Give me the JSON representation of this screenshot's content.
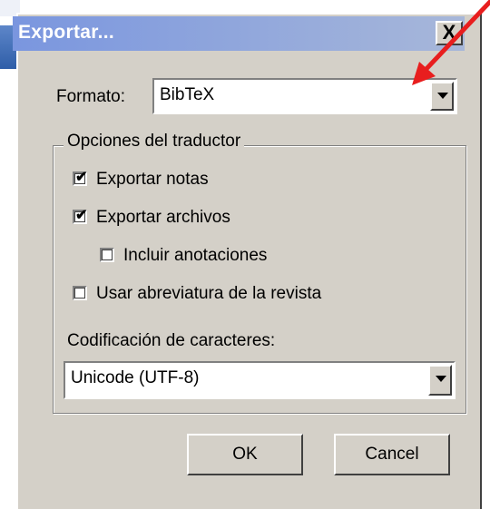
{
  "window": {
    "title": "Exportar...",
    "close_label": "X"
  },
  "format": {
    "label": "Formato:",
    "value": "BibTeX"
  },
  "translator_options": {
    "title": "Opciones del traductor",
    "export_notes": {
      "label": "Exportar notas",
      "checked": true
    },
    "export_files": {
      "label": "Exportar archivos",
      "checked": true
    },
    "include_annotations": {
      "label": "Incluir anotaciones",
      "checked": false
    },
    "use_journal_abbreviation": {
      "label": "Usar abreviatura de la revista",
      "checked": false
    },
    "encoding_label": "Codificación de caracteres:",
    "encoding_value": "Unicode (UTF-8)"
  },
  "buttons": {
    "ok": "OK",
    "cancel": "Cancel"
  },
  "colors": {
    "dialog_bg": "#d4d0c8",
    "title_gradient_start": "#7a96df",
    "title_gradient_end": "#a7b7d9",
    "annotation_arrow": "#e81e1e"
  }
}
